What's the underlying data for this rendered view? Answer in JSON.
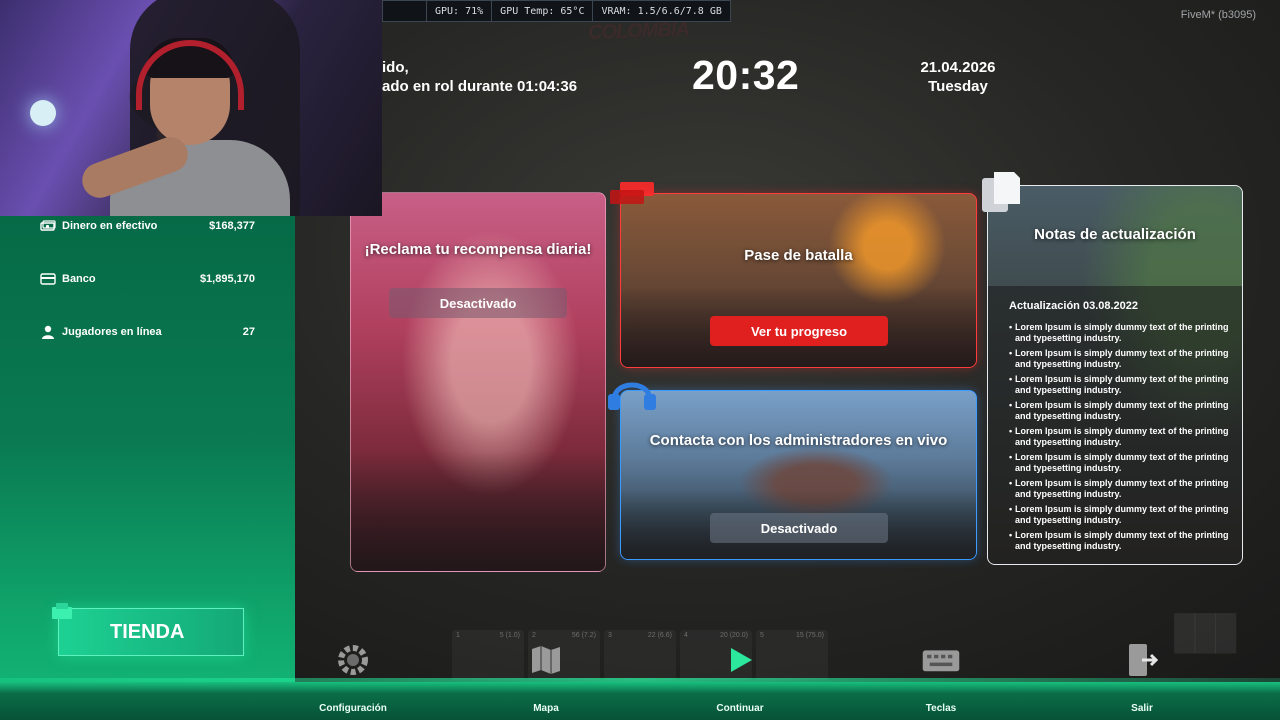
{
  "perf": [
    "GPU: 71%",
    "GPU Temp: 65°C",
    "VRAM: 1.5/6.6/7.8 GB"
  ],
  "fivem_label": "FiveM* (b3095)",
  "server_logo": "COLOMBIA",
  "welcome": {
    "line1": "ido,",
    "line2": "ado en rol durante 01:04:36"
  },
  "clock": "20:32",
  "date": {
    "day": "21.04.2026",
    "weekday": "Tuesday"
  },
  "stats": [
    {
      "icon": "money-stack-icon",
      "label": "Dinero en efectivo",
      "value": "$168,377"
    },
    {
      "icon": "credit-card-icon",
      "label": "Banco",
      "value": "$1,895,170"
    },
    {
      "icon": "user-icon",
      "label": "Jugadores en línea",
      "value": "27"
    }
  ],
  "tienda": "TIENDA",
  "cards": {
    "daily": {
      "title": "¡Reclama tu recompensa diaria!",
      "button": "Desactivado"
    },
    "battle": {
      "title": "Pase de batalla",
      "button": "Ver tu progreso"
    },
    "support": {
      "title": "Contacta con los administradores en vivo",
      "button": "Desactivado"
    },
    "notes": {
      "title": "Notas de actualización",
      "date": "Actualización 03.08.2022",
      "items": [
        "Lorem Ipsum is simply dummy text of the printing and typesetting industry.",
        "Lorem Ipsum is simply dummy text of the printing and typesetting industry.",
        "Lorem Ipsum is simply dummy text of the printing and typesetting industry.",
        "Lorem Ipsum is simply dummy text of the printing and typesetting industry.",
        "Lorem Ipsum is simply dummy text of the printing and typesetting industry.",
        "Lorem Ipsum is simply dummy text of the printing and typesetting industry.",
        "Lorem Ipsum is simply dummy text of the printing and typesetting industry.",
        "Lorem Ipsum is simply dummy text of the printing and typesetting industry.",
        "Lorem Ipsum is simply dummy text of the printing and typesetting industry."
      ]
    }
  },
  "hotbar": [
    {
      "num": "1",
      "info": "5 (1.0)"
    },
    {
      "num": "2",
      "info": "56 (7.2)"
    },
    {
      "num": "3",
      "info": "22 (6.6)"
    },
    {
      "num": "4",
      "info": "20 (20.0)"
    },
    {
      "num": "5",
      "info": "15 (75.0)"
    }
  ],
  "nav": [
    {
      "label": "Configuración",
      "icon": "gear-icon"
    },
    {
      "label": "Mapa",
      "icon": "map-icon"
    },
    {
      "label": "Continuar",
      "icon": "play-icon"
    },
    {
      "label": "Teclas",
      "icon": "keyboard-icon"
    },
    {
      "label": "Salir",
      "icon": "exit-icon"
    }
  ],
  "colors": {
    "panel_green": "#0a7a52",
    "battle_red": "#e01f1f",
    "support_blue": "#3b9bff",
    "tienda_green": "#1dd193"
  }
}
